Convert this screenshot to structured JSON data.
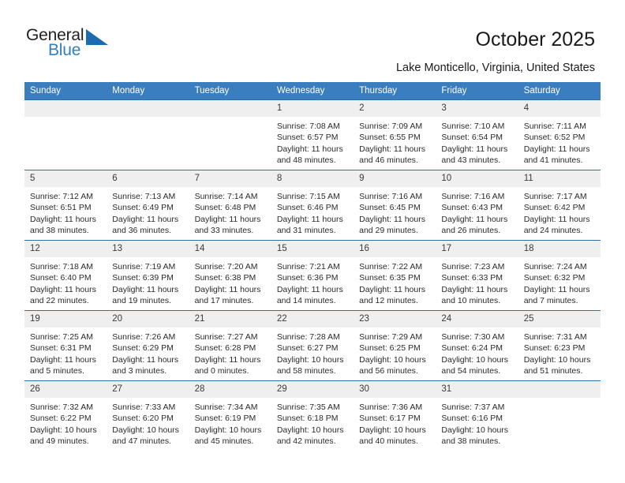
{
  "brand": {
    "name_top": "General",
    "name_bottom": "Blue",
    "triangle_icon": "triangle-icon",
    "accent_color": "#1b6bb0",
    "blue_text_color": "#2f7fc1"
  },
  "header": {
    "title": "October 2025",
    "location": "Lake Monticello, Virginia, United States"
  },
  "calendar": {
    "header_bg": "#3b7ebf",
    "daynum_bg": "#efefef",
    "weekdays": [
      "Sunday",
      "Monday",
      "Tuesday",
      "Wednesday",
      "Thursday",
      "Friday",
      "Saturday"
    ],
    "weeks": [
      [
        {
          "day": "",
          "empty": true
        },
        {
          "day": "",
          "empty": true
        },
        {
          "day": "",
          "empty": true
        },
        {
          "day": "1",
          "sunrise": "Sunrise: 7:08 AM",
          "sunset": "Sunset: 6:57 PM",
          "daylight": "Daylight: 11 hours and 48 minutes."
        },
        {
          "day": "2",
          "sunrise": "Sunrise: 7:09 AM",
          "sunset": "Sunset: 6:55 PM",
          "daylight": "Daylight: 11 hours and 46 minutes."
        },
        {
          "day": "3",
          "sunrise": "Sunrise: 7:10 AM",
          "sunset": "Sunset: 6:54 PM",
          "daylight": "Daylight: 11 hours and 43 minutes."
        },
        {
          "day": "4",
          "sunrise": "Sunrise: 7:11 AM",
          "sunset": "Sunset: 6:52 PM",
          "daylight": "Daylight: 11 hours and 41 minutes."
        }
      ],
      [
        {
          "day": "5",
          "sunrise": "Sunrise: 7:12 AM",
          "sunset": "Sunset: 6:51 PM",
          "daylight": "Daylight: 11 hours and 38 minutes."
        },
        {
          "day": "6",
          "sunrise": "Sunrise: 7:13 AM",
          "sunset": "Sunset: 6:49 PM",
          "daylight": "Daylight: 11 hours and 36 minutes."
        },
        {
          "day": "7",
          "sunrise": "Sunrise: 7:14 AM",
          "sunset": "Sunset: 6:48 PM",
          "daylight": "Daylight: 11 hours and 33 minutes."
        },
        {
          "day": "8",
          "sunrise": "Sunrise: 7:15 AM",
          "sunset": "Sunset: 6:46 PM",
          "daylight": "Daylight: 11 hours and 31 minutes."
        },
        {
          "day": "9",
          "sunrise": "Sunrise: 7:16 AM",
          "sunset": "Sunset: 6:45 PM",
          "daylight": "Daylight: 11 hours and 29 minutes."
        },
        {
          "day": "10",
          "sunrise": "Sunrise: 7:16 AM",
          "sunset": "Sunset: 6:43 PM",
          "daylight": "Daylight: 11 hours and 26 minutes."
        },
        {
          "day": "11",
          "sunrise": "Sunrise: 7:17 AM",
          "sunset": "Sunset: 6:42 PM",
          "daylight": "Daylight: 11 hours and 24 minutes."
        }
      ],
      [
        {
          "day": "12",
          "sunrise": "Sunrise: 7:18 AM",
          "sunset": "Sunset: 6:40 PM",
          "daylight": "Daylight: 11 hours and 22 minutes."
        },
        {
          "day": "13",
          "sunrise": "Sunrise: 7:19 AM",
          "sunset": "Sunset: 6:39 PM",
          "daylight": "Daylight: 11 hours and 19 minutes."
        },
        {
          "day": "14",
          "sunrise": "Sunrise: 7:20 AM",
          "sunset": "Sunset: 6:38 PM",
          "daylight": "Daylight: 11 hours and 17 minutes."
        },
        {
          "day": "15",
          "sunrise": "Sunrise: 7:21 AM",
          "sunset": "Sunset: 6:36 PM",
          "daylight": "Daylight: 11 hours and 14 minutes."
        },
        {
          "day": "16",
          "sunrise": "Sunrise: 7:22 AM",
          "sunset": "Sunset: 6:35 PM",
          "daylight": "Daylight: 11 hours and 12 minutes."
        },
        {
          "day": "17",
          "sunrise": "Sunrise: 7:23 AM",
          "sunset": "Sunset: 6:33 PM",
          "daylight": "Daylight: 11 hours and 10 minutes."
        },
        {
          "day": "18",
          "sunrise": "Sunrise: 7:24 AM",
          "sunset": "Sunset: 6:32 PM",
          "daylight": "Daylight: 11 hours and 7 minutes."
        }
      ],
      [
        {
          "day": "19",
          "sunrise": "Sunrise: 7:25 AM",
          "sunset": "Sunset: 6:31 PM",
          "daylight": "Daylight: 11 hours and 5 minutes."
        },
        {
          "day": "20",
          "sunrise": "Sunrise: 7:26 AM",
          "sunset": "Sunset: 6:29 PM",
          "daylight": "Daylight: 11 hours and 3 minutes."
        },
        {
          "day": "21",
          "sunrise": "Sunrise: 7:27 AM",
          "sunset": "Sunset: 6:28 PM",
          "daylight": "Daylight: 11 hours and 0 minutes."
        },
        {
          "day": "22",
          "sunrise": "Sunrise: 7:28 AM",
          "sunset": "Sunset: 6:27 PM",
          "daylight": "Daylight: 10 hours and 58 minutes."
        },
        {
          "day": "23",
          "sunrise": "Sunrise: 7:29 AM",
          "sunset": "Sunset: 6:25 PM",
          "daylight": "Daylight: 10 hours and 56 minutes."
        },
        {
          "day": "24",
          "sunrise": "Sunrise: 7:30 AM",
          "sunset": "Sunset: 6:24 PM",
          "daylight": "Daylight: 10 hours and 54 minutes."
        },
        {
          "day": "25",
          "sunrise": "Sunrise: 7:31 AM",
          "sunset": "Sunset: 6:23 PM",
          "daylight": "Daylight: 10 hours and 51 minutes."
        }
      ],
      [
        {
          "day": "26",
          "sunrise": "Sunrise: 7:32 AM",
          "sunset": "Sunset: 6:22 PM",
          "daylight": "Daylight: 10 hours and 49 minutes."
        },
        {
          "day": "27",
          "sunrise": "Sunrise: 7:33 AM",
          "sunset": "Sunset: 6:20 PM",
          "daylight": "Daylight: 10 hours and 47 minutes."
        },
        {
          "day": "28",
          "sunrise": "Sunrise: 7:34 AM",
          "sunset": "Sunset: 6:19 PM",
          "daylight": "Daylight: 10 hours and 45 minutes."
        },
        {
          "day": "29",
          "sunrise": "Sunrise: 7:35 AM",
          "sunset": "Sunset: 6:18 PM",
          "daylight": "Daylight: 10 hours and 42 minutes."
        },
        {
          "day": "30",
          "sunrise": "Sunrise: 7:36 AM",
          "sunset": "Sunset: 6:17 PM",
          "daylight": "Daylight: 10 hours and 40 minutes."
        },
        {
          "day": "31",
          "sunrise": "Sunrise: 7:37 AM",
          "sunset": "Sunset: 6:16 PM",
          "daylight": "Daylight: 10 hours and 38 minutes."
        },
        {
          "day": "",
          "empty": true
        }
      ]
    ]
  }
}
